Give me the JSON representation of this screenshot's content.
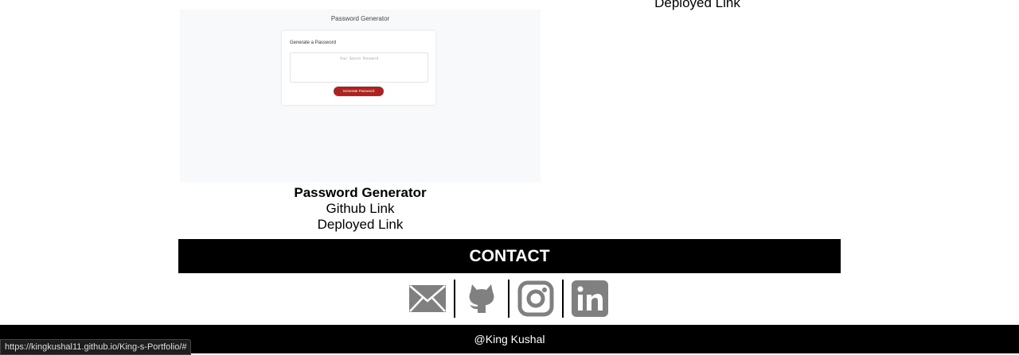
{
  "top": {
    "deployed_link": "Deployed Link"
  },
  "project": {
    "preview": {
      "title": "Password Generator",
      "card_heading": "Generate a Password",
      "placeholder": "Your Secure Password",
      "button": "Generate Password"
    },
    "name": "Password Generator",
    "github_link": "Github Link",
    "deployed_link": "Deployed Link"
  },
  "contact": {
    "heading": "CONTACT",
    "icons": [
      "email-icon",
      "github-icon",
      "instagram-icon",
      "linkedin-icon"
    ],
    "icon_color": "#808080"
  },
  "footer": {
    "text": "@King Kushal"
  },
  "status_bar": {
    "url": "https://kingkushal11.github.io/King-s-Portfolio/#"
  }
}
